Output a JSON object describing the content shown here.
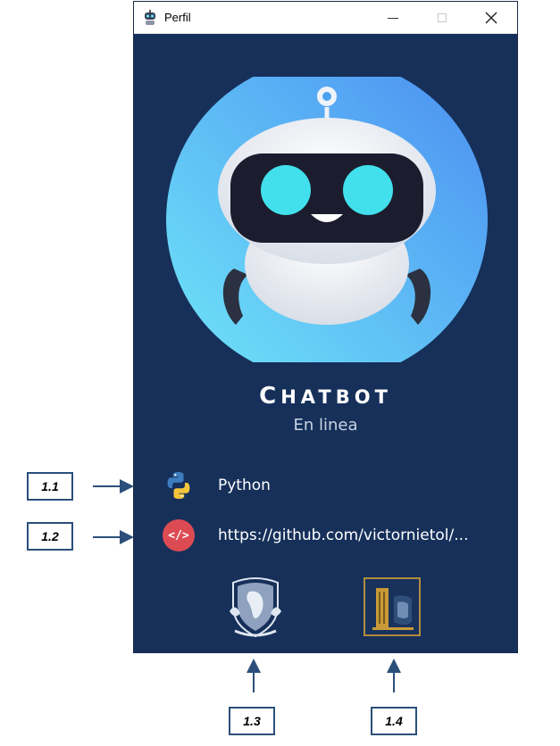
{
  "window": {
    "title": "Perfil",
    "controls": [
      "minimize",
      "maximize",
      "close"
    ]
  },
  "profile": {
    "name_first": "C",
    "name_rest": "HATBOT",
    "status": "En linea",
    "language": "Python",
    "repo_url": "https://github.com/victornietol/...",
    "code_badge": "</>"
  },
  "annotations": {
    "a1": "1.1",
    "a2": "1.2",
    "a3": "1.3",
    "a4": "1.4"
  },
  "colors": {
    "background": "#16305a",
    "avatar_gradient_start": "#6fe6f7",
    "avatar_gradient_end": "#4b8df2",
    "badge": "#dc4b53",
    "annotation_border": "#2b4f7a"
  },
  "icons": {
    "app": "robot-icon",
    "python": "python-logo-icon",
    "code": "code-icon",
    "unam": "unam-crest-logo",
    "faculty": "faculty-building-logo"
  }
}
